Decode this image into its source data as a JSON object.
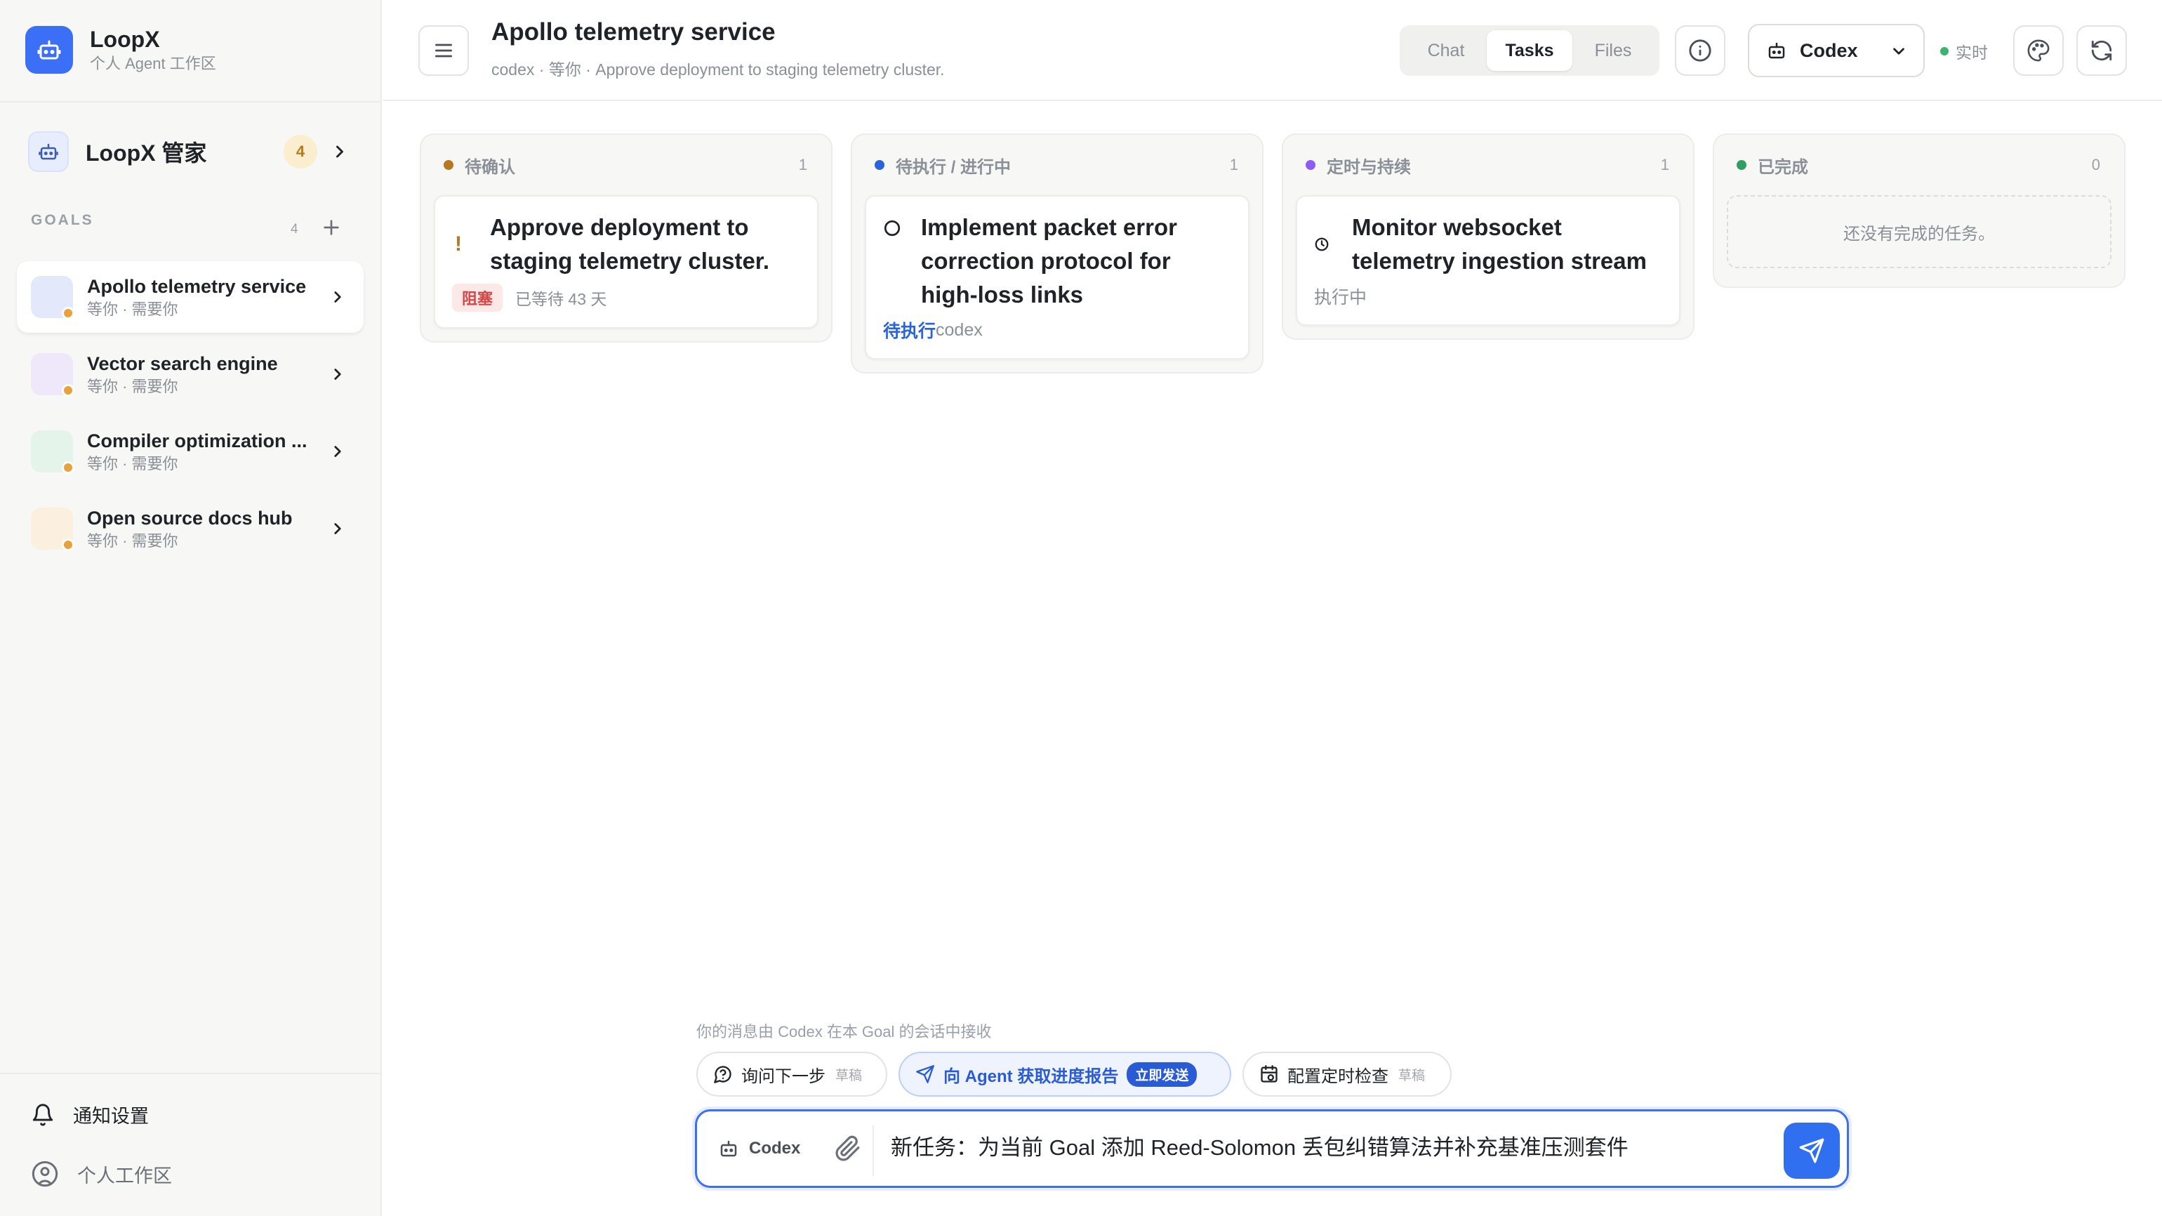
{
  "brand": {
    "name": "LoopX",
    "subtitle": "个人 Agent 工作区"
  },
  "butler": {
    "label": "LoopX 管家",
    "badge": "4"
  },
  "goals": {
    "section_label": "GOALS",
    "count": "4",
    "items": [
      {
        "title": "Apollo telemetry service",
        "sub": "等你 · 需要你",
        "avatar_color": "#e3e9fb",
        "active": true
      },
      {
        "title": "Vector search engine",
        "sub": "等你 · 需要你",
        "avatar_color": "#efe8fb",
        "active": false
      },
      {
        "title": "Compiler optimization ...",
        "sub": "等你 · 需要你",
        "avatar_color": "#e5f4ea",
        "active": false
      },
      {
        "title": "Open source docs hub",
        "sub": "等你 · 需要你",
        "avatar_color": "#fbf0dd",
        "active": false
      }
    ]
  },
  "footer": {
    "notifications": "通知设置",
    "workspace": "个人工作区"
  },
  "header": {
    "title": "Apollo telemetry service",
    "subtitle": "codex · 等你 · Approve deployment to staging telemetry cluster.",
    "tabs": [
      "Chat",
      "Tasks",
      "Files"
    ],
    "active_tab": "Tasks",
    "agent": "Codex",
    "live": "实时"
  },
  "columns": [
    {
      "title": "待确认",
      "count": "1",
      "dot_color": "#b7791f",
      "cards": [
        {
          "title": "Approve deployment to staging telemetry cluster.",
          "tag": "阻塞",
          "meta": "已等待 43 天",
          "icon": "exclamation-icon"
        }
      ]
    },
    {
      "title": "待执行 / 进行中",
      "count": "1",
      "dot_color": "#2a64d8",
      "cards": [
        {
          "title": "Implement packet error correction protocol for high-loss links",
          "status": "待执行",
          "meta": "codex",
          "icon": "circle-icon"
        }
      ]
    },
    {
      "title": "定时与持续",
      "count": "1",
      "dot_color": "#8b5cf6",
      "cards": [
        {
          "title": "Monitor websocket telemetry ingestion stream",
          "meta": "执行中",
          "icon": "clock-icon"
        }
      ]
    },
    {
      "title": "已完成",
      "count": "0",
      "dot_color": "#2f9e5e",
      "empty": "还没有完成的任务。"
    }
  ],
  "composer": {
    "hint": "你的消息由 Codex 在本 Goal 的会话中接收",
    "chips": [
      {
        "label": "询问下一步",
        "draft": "草稿"
      },
      {
        "label": "向 Agent 获取进度报告",
        "badge": "立即发送"
      },
      {
        "label": "配置定时检查",
        "draft": "草稿"
      }
    ],
    "agent": "Codex",
    "input_value": "新任务：为当前 Goal 添加 Reed-Solomon 丢包纠错算法并补充基准压测套件"
  },
  "colors": {
    "accent": "#3b6ff5",
    "warning": "#e9a23b",
    "danger": "#d64545",
    "live": "#3cb371"
  }
}
